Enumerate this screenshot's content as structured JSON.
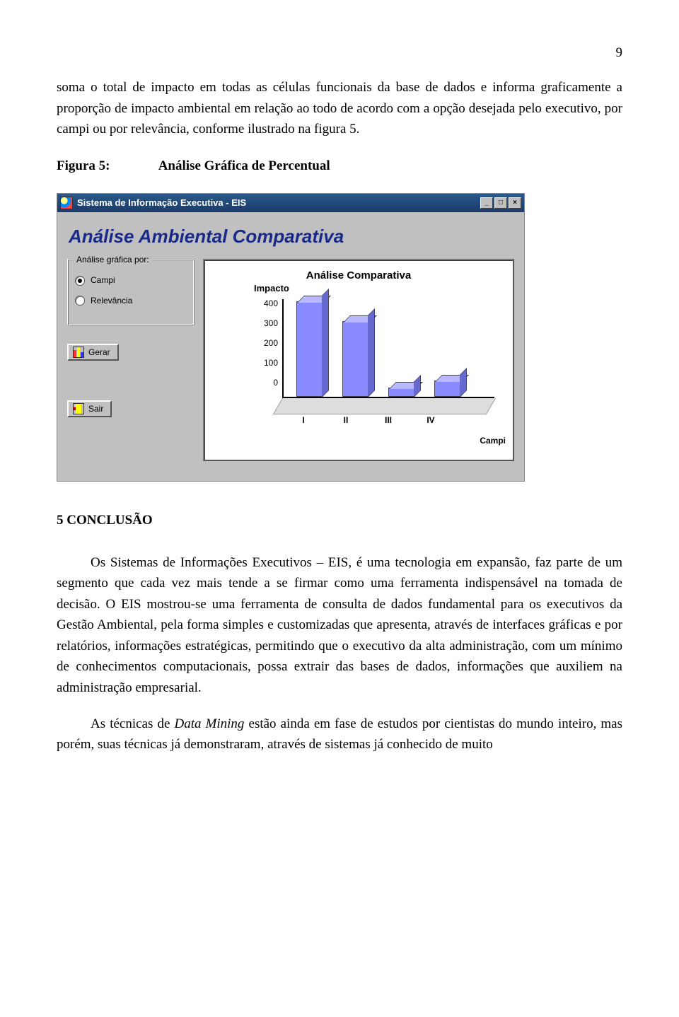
{
  "page_number": "9",
  "paragraphs": {
    "p1": "soma o total de impacto em todas as células funcionais da base de dados e informa graficamente a proporção de impacto ambiental em relação ao todo de acordo com a opção desejada pelo executivo, por campi ou por relevância, conforme ilustrado na figura 5.",
    "fig_label": "Figura 5:",
    "fig_title": "Análise Gráfica de Percentual",
    "section_heading": "5  CONCLUSÃO",
    "p2_a": "Os Sistemas de Informações Executivos – EIS, é uma tecnologia em expansão, faz parte de um segmento que cada vez mais tende a se firmar como uma ferramenta indispensável na tomada de decisão. O EIS mostrou-se uma ferramenta de consulta de dados fundamental para os executivos da  Gestão Ambiental, pela forma simples e customizadas que apresenta, através de interfaces gráficas e por relatórios, informações estratégicas, permitindo que o executivo da alta administração, com um mínimo de conhecimentos computacionais, possa extrair das bases de dados, informações que auxiliem na administração empresarial.",
    "p3_a": "As técnicas de ",
    "p3_em": "Data Mining",
    "p3_b": " estão ainda em fase de estudos por cientistas do mundo inteiro, mas porém, suas técnicas já demonstraram, através de sistemas já conhecido de muito"
  },
  "app": {
    "title": "Sistema de Informação Executiva - EIS",
    "heading": "Análise Ambiental Comparativa",
    "group_legend": "Análise gráfica por:",
    "radio_campi": "Campi",
    "radio_relevancia": "Relevância",
    "btn_gerar": "Gerar",
    "btn_sair": "Sair",
    "win_min": "_",
    "win_max": "□",
    "win_close": "×"
  },
  "chart_data": {
    "type": "bar",
    "title": "Análise Comparativa",
    "ylabel": "Impacto",
    "xlabel": "Campi",
    "categories": [
      "I",
      "II",
      "III",
      "IV"
    ],
    "values": [
      380,
      300,
      30,
      60
    ],
    "yticks": [
      "400",
      "300",
      "200",
      "100",
      "0"
    ],
    "ylim": [
      0,
      400
    ]
  }
}
